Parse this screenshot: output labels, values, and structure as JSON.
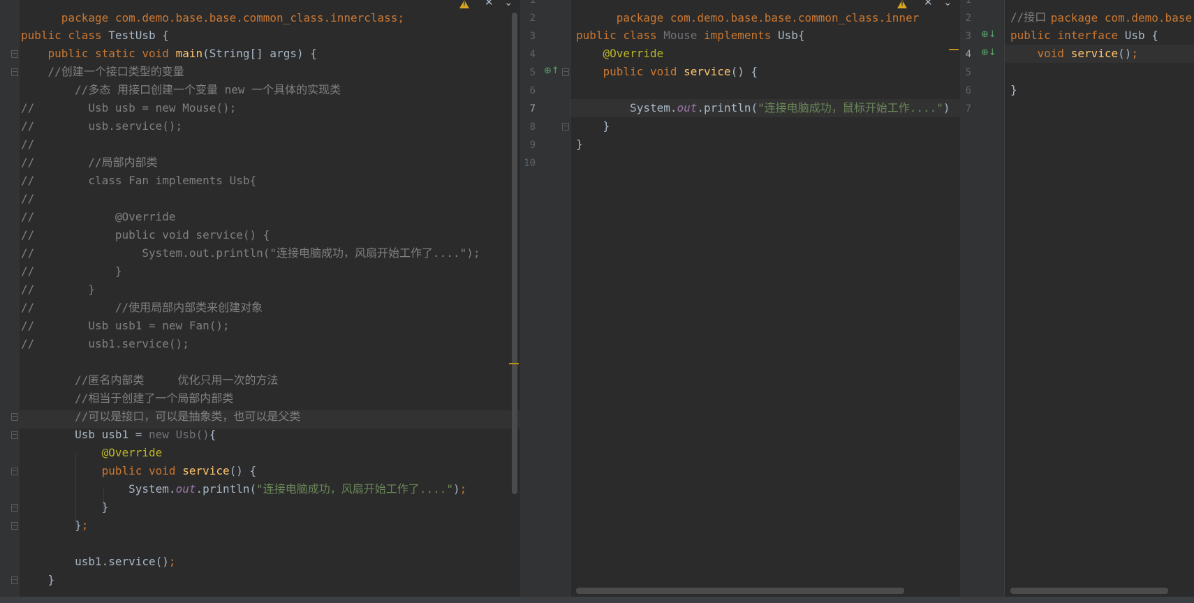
{
  "left": {
    "title_line": "package com.demo.base.base.common_class.innerclass;",
    "lines": [
      {
        "segs": [
          {
            "t": "public ",
            "c": "kw"
          },
          {
            "t": "class ",
            "c": "kw"
          },
          {
            "t": "TestUsb {",
            "c": ""
          }
        ]
      },
      {
        "segs": [
          {
            "t": "    public static void ",
            "c": "kw"
          },
          {
            "t": "main",
            "c": "fn"
          },
          {
            "t": "(String[] args) {",
            "c": ""
          }
        ]
      },
      {
        "segs": [
          {
            "t": "    //创建一个接口类型的变量",
            "c": "cm"
          }
        ]
      },
      {
        "segs": [
          {
            "t": "        //多态 用接口创建一个变量 new 一个具体的实现类",
            "c": "cm"
          }
        ]
      },
      {
        "segs": [
          {
            "t": "//        Usb usb = new Mouse();",
            "c": "cm"
          }
        ]
      },
      {
        "segs": [
          {
            "t": "//        usb.service();",
            "c": "cm"
          }
        ]
      },
      {
        "segs": [
          {
            "t": "//",
            "c": "cm"
          }
        ]
      },
      {
        "segs": [
          {
            "t": "//        //局部内部类",
            "c": "cm"
          }
        ]
      },
      {
        "segs": [
          {
            "t": "//        class Fan implements Usb{",
            "c": "cm"
          }
        ]
      },
      {
        "segs": [
          {
            "t": "//",
            "c": "cm"
          }
        ]
      },
      {
        "segs": [
          {
            "t": "//            @Override",
            "c": "cm"
          }
        ]
      },
      {
        "segs": [
          {
            "t": "//            public void service() {",
            "c": "cm"
          }
        ]
      },
      {
        "segs": [
          {
            "t": "//                System.out.println(\"连接电脑成功，风扇开始工作了....\");",
            "c": "cm"
          }
        ]
      },
      {
        "segs": [
          {
            "t": "//            }",
            "c": "cm"
          }
        ]
      },
      {
        "segs": [
          {
            "t": "//        }",
            "c": "cm"
          }
        ]
      },
      {
        "segs": [
          {
            "t": "//            //使用局部内部类来创建对象",
            "c": "cm"
          }
        ]
      },
      {
        "segs": [
          {
            "t": "//        Usb usb1 = new Fan();",
            "c": "cm"
          }
        ]
      },
      {
        "segs": [
          {
            "t": "//        usb1.service();",
            "c": "cm"
          }
        ]
      },
      {
        "segs": [
          {
            "t": "",
            "c": ""
          }
        ]
      },
      {
        "segs": [
          {
            "t": "        //匿名内部类     优化只用一次的方法",
            "c": "cm"
          }
        ]
      },
      {
        "segs": [
          {
            "t": "        //相当于创建了一个局部内部类",
            "c": "cm"
          }
        ]
      },
      {
        "segs": [
          {
            "t": "        //可以是接口，可以是抽象类，也可以是父类",
            "c": "cm"
          }
        ]
      },
      {
        "segs": [
          {
            "t": "        Usb usb1 = ",
            "c": ""
          },
          {
            "t": "new Usb()",
            "c": "dim"
          },
          {
            "t": "{",
            "c": ""
          }
        ]
      },
      {
        "segs": [
          {
            "t": "            ",
            "c": ""
          },
          {
            "t": "@Override",
            "c": "ann"
          }
        ]
      },
      {
        "segs": [
          {
            "t": "            ",
            "c": ""
          },
          {
            "t": "public void ",
            "c": "kw"
          },
          {
            "t": "service",
            "c": "fn"
          },
          {
            "t": "() {",
            "c": ""
          }
        ]
      },
      {
        "segs": [
          {
            "t": "                System.",
            "c": ""
          },
          {
            "t": "out",
            "c": "fld"
          },
          {
            "t": ".println(",
            "c": ""
          },
          {
            "t": "\"连接电脑成功，风扇开始工作了....\"",
            "c": "str"
          },
          {
            "t": ")",
            "c": ""
          },
          {
            "t": ";",
            "c": "kw"
          }
        ]
      },
      {
        "segs": [
          {
            "t": "            }",
            "c": ""
          }
        ]
      },
      {
        "segs": [
          {
            "t": "        }",
            "c": ""
          },
          {
            "t": ";",
            "c": "kw"
          }
        ]
      },
      {
        "segs": [
          {
            "t": "",
            "c": ""
          }
        ]
      },
      {
        "segs": [
          {
            "t": "        usb1.service()",
            "c": ""
          },
          {
            "t": ";",
            "c": "kw"
          }
        ]
      },
      {
        "segs": [
          {
            "t": "    }",
            "c": ""
          }
        ]
      }
    ]
  },
  "middle": {
    "title_line": "package com.demo.base.base.common_class.inner",
    "line_numbers": [
      "1",
      "2",
      "3",
      "4",
      "5",
      "6",
      "7",
      "8",
      "9",
      "10"
    ],
    "lines": [
      {
        "segs": [
          {
            "t": "",
            "c": ""
          }
        ]
      },
      {
        "segs": [
          {
            "t": "public ",
            "c": "kw"
          },
          {
            "t": "class ",
            "c": "kw"
          },
          {
            "t": "Mouse ",
            "c": "dim"
          },
          {
            "t": "implements ",
            "c": "kw"
          },
          {
            "t": "Usb{",
            "c": ""
          }
        ]
      },
      {
        "segs": [
          {
            "t": "    ",
            "c": ""
          },
          {
            "t": "@Override",
            "c": "ann"
          }
        ]
      },
      {
        "segs": [
          {
            "t": "    ",
            "c": ""
          },
          {
            "t": "public void ",
            "c": "kw"
          },
          {
            "t": "service",
            "c": "fn"
          },
          {
            "t": "() {",
            "c": ""
          }
        ]
      },
      {
        "segs": [
          {
            "t": "",
            "c": ""
          }
        ]
      },
      {
        "segs": [
          {
            "t": "        System.",
            "c": ""
          },
          {
            "t": "out",
            "c": "fld"
          },
          {
            "t": ".println(",
            "c": ""
          },
          {
            "t": "\"连接电脑成功，鼠标开始工作....\"",
            "c": "str"
          },
          {
            "t": ")",
            "c": ""
          }
        ]
      },
      {
        "segs": [
          {
            "t": "    }",
            "c": ""
          }
        ]
      },
      {
        "segs": [
          {
            "t": "}",
            "c": ""
          }
        ]
      },
      {
        "segs": [
          {
            "t": "",
            "c": ""
          }
        ]
      }
    ]
  },
  "right": {
    "title_line": "package com.demo.base.base",
    "line_numbers": [
      "1",
      "2",
      "3",
      "4",
      "5",
      "6",
      "7"
    ],
    "lines": [
      {
        "segs": [
          {
            "t": "//接口",
            "c": "cm"
          }
        ]
      },
      {
        "segs": [
          {
            "t": "public ",
            "c": "kw"
          },
          {
            "t": "interface ",
            "c": "kw"
          },
          {
            "t": "Usb {",
            "c": ""
          }
        ]
      },
      {
        "segs": [
          {
            "t": "    void ",
            "c": "kw"
          },
          {
            "t": "service",
            "c": "fn"
          },
          {
            "t": "()",
            "c": ""
          },
          {
            "t": ";",
            "c": "kw"
          }
        ]
      },
      {
        "segs": [
          {
            "t": "",
            "c": ""
          }
        ]
      },
      {
        "segs": [
          {
            "t": "}",
            "c": ""
          }
        ]
      }
    ]
  },
  "icons": {
    "warning": "warning-icon",
    "close": "close-icon",
    "expand": "chevron-down-icon",
    "implemented": "implemented-by-icon",
    "implements": "implements-icon"
  },
  "colors": {
    "background": "#2b2b2b",
    "keyword": "#cc7832",
    "method": "#ffc66d",
    "string": "#6a8759",
    "comment": "#808080",
    "annotation": "#bbb529"
  }
}
